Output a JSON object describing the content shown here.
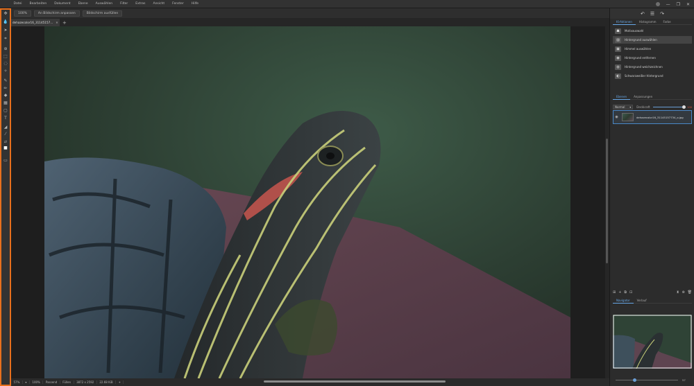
{
  "menu": {
    "items": [
      "Datei",
      "Bearbeiten",
      "Dokument",
      "Ebene",
      "Auswählen",
      "Filter",
      "Extras",
      "Ansicht",
      "Fenster",
      "Hilfe"
    ]
  },
  "window_controls": {
    "minimize": "—",
    "restore": "❐",
    "close": "✕"
  },
  "toolbar": {
    "tools": [
      {
        "name": "move-icon",
        "glyph": "✥"
      },
      {
        "name": "droplet-icon",
        "glyph": "💧"
      },
      {
        "name": "pointer-icon",
        "glyph": "➤"
      },
      {
        "name": "crop-icon",
        "glyph": "⌗"
      },
      {
        "name": "zoom-icon",
        "glyph": "⊕"
      },
      {
        "name": "rectangle-select-icon",
        "glyph": "⬚"
      },
      {
        "name": "lasso-icon",
        "glyph": "◌"
      },
      {
        "name": "magic-wand-icon",
        "glyph": "✧"
      },
      {
        "name": "brush-icon",
        "glyph": "✎"
      },
      {
        "name": "pencil-icon",
        "glyph": "✏"
      },
      {
        "name": "stamp-icon",
        "glyph": "◆"
      },
      {
        "name": "gradient-icon",
        "glyph": "▦"
      },
      {
        "name": "shape-icon",
        "glyph": "▢"
      },
      {
        "name": "text-icon",
        "glyph": "T"
      },
      {
        "name": "eraser-icon",
        "glyph": "◢"
      },
      {
        "name": "eyedropper-icon",
        "glyph": "⁄"
      },
      {
        "name": "swap-colors-icon",
        "glyph": "⇄"
      },
      {
        "name": "color-swatch-icon",
        "glyph": "■"
      },
      {
        "name": "mask-mode-icon",
        "glyph": "▭"
      }
    ]
  },
  "options": {
    "zoom_value": "100%",
    "fit_label": "An Bildschirm anpassen",
    "fill_label": "Bildschirm ausfüllen"
  },
  "document_tab": {
    "title": "dehazecolor16_31145157...",
    "close": "✕",
    "new": "+"
  },
  "status": {
    "zoom": "57%",
    "arrow": "▾",
    "zoom2": "100%",
    "fit": "Passend",
    "fill": "Füllen",
    "dimensions": "3872 x 2592",
    "size": "22.68 KiB",
    "plus": "+"
  },
  "right_panel": {
    "header_icons": {
      "undo": "↶",
      "menu": "☰",
      "redo": "↷"
    },
    "top_tabs": [
      "KI-Aktionen",
      "Histogramm",
      "Farbe"
    ],
    "ai_actions": [
      {
        "label": "Motivauswahl",
        "icon": "person-icon",
        "glyph": "☗"
      },
      {
        "label": "Hintergrund auswählen",
        "icon": "background-select-icon",
        "glyph": "▨"
      },
      {
        "label": "Himmel auswählen",
        "icon": "sky-icon",
        "glyph": "▣"
      },
      {
        "label": "Hintergrund entfernen",
        "icon": "remove-background-icon",
        "glyph": "◉"
      },
      {
        "label": "Hintergrund weichzeichnen",
        "icon": "blur-background-icon",
        "glyph": "◍"
      },
      {
        "label": "Schwarzweißer Hintergrund",
        "icon": "bw-background-icon",
        "glyph": "◐"
      }
    ],
    "layer_tabs": [
      "Ebenen",
      "Anpassungen"
    ],
    "blend_mode": "Normal",
    "opacity_label": "Deckkraft",
    "opacity_value": "100",
    "opacity_level": 1.0,
    "layer_name": "dehazecolor16_31145157734_o.jpg",
    "layer_actions": [
      "⊞",
      "+",
      "⧉",
      "⊡"
    ],
    "layer_actions_right": [
      "⧗",
      "⊗",
      "🗑"
    ],
    "nav_tabs": [
      "Navigator",
      "Verlauf"
    ],
    "nav_zoom": "57",
    "nav_zoom_level": 0.31
  }
}
